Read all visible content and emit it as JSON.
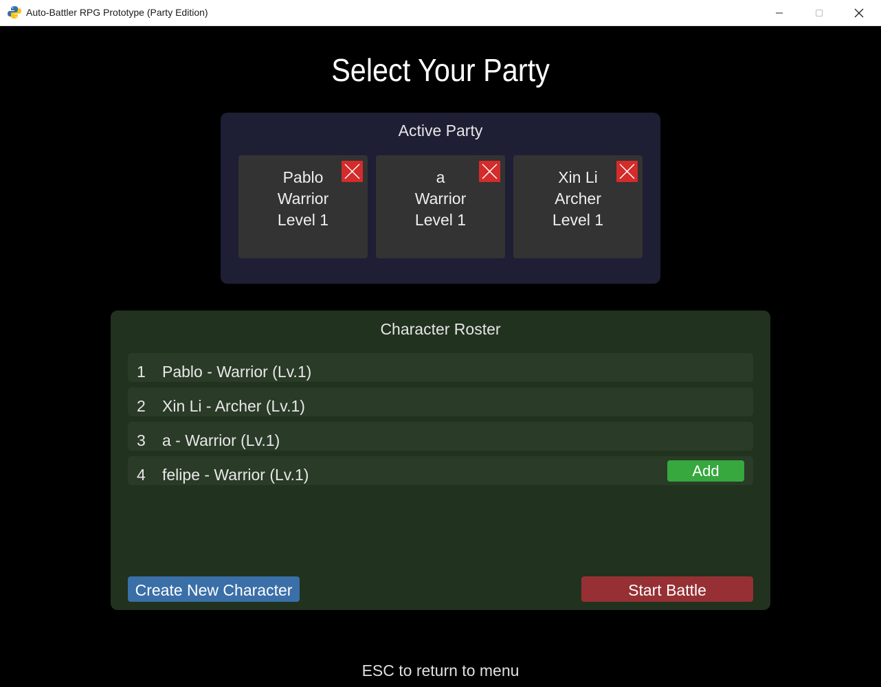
{
  "window": {
    "title": "Auto-Battler RPG Prototype (Party Edition)",
    "icon": "python-snake-icon"
  },
  "page": {
    "title": "Select Your Party",
    "footer_hint": "ESC to return to menu"
  },
  "active_party": {
    "title": "Active Party",
    "members": [
      {
        "name": "Pablo",
        "class": "Warrior",
        "level": "Level 1"
      },
      {
        "name": "a",
        "class": "Warrior",
        "level": "Level 1"
      },
      {
        "name": "Xin Li",
        "class": "Archer",
        "level": "Level 1"
      }
    ]
  },
  "roster": {
    "title": "Character Roster",
    "items": [
      {
        "num": "1",
        "label": "Pablo - Warrior (Lv.1)"
      },
      {
        "num": "2",
        "label": "Xin Li - Archer (Lv.1)"
      },
      {
        "num": "3",
        "label": "a - Warrior (Lv.1)"
      },
      {
        "num": "4",
        "label": "felipe - Warrior (Lv.1)",
        "action": "Add"
      }
    ],
    "create_button": "Create New Character",
    "start_button": "Start Battle"
  },
  "colors": {
    "party_panel_bg": "#1e1e35",
    "roster_panel_bg": "#21321f",
    "remove_red": "#d42b2b",
    "add_green": "#36a83e",
    "create_blue": "#3a6fa8",
    "start_red": "#963035"
  }
}
